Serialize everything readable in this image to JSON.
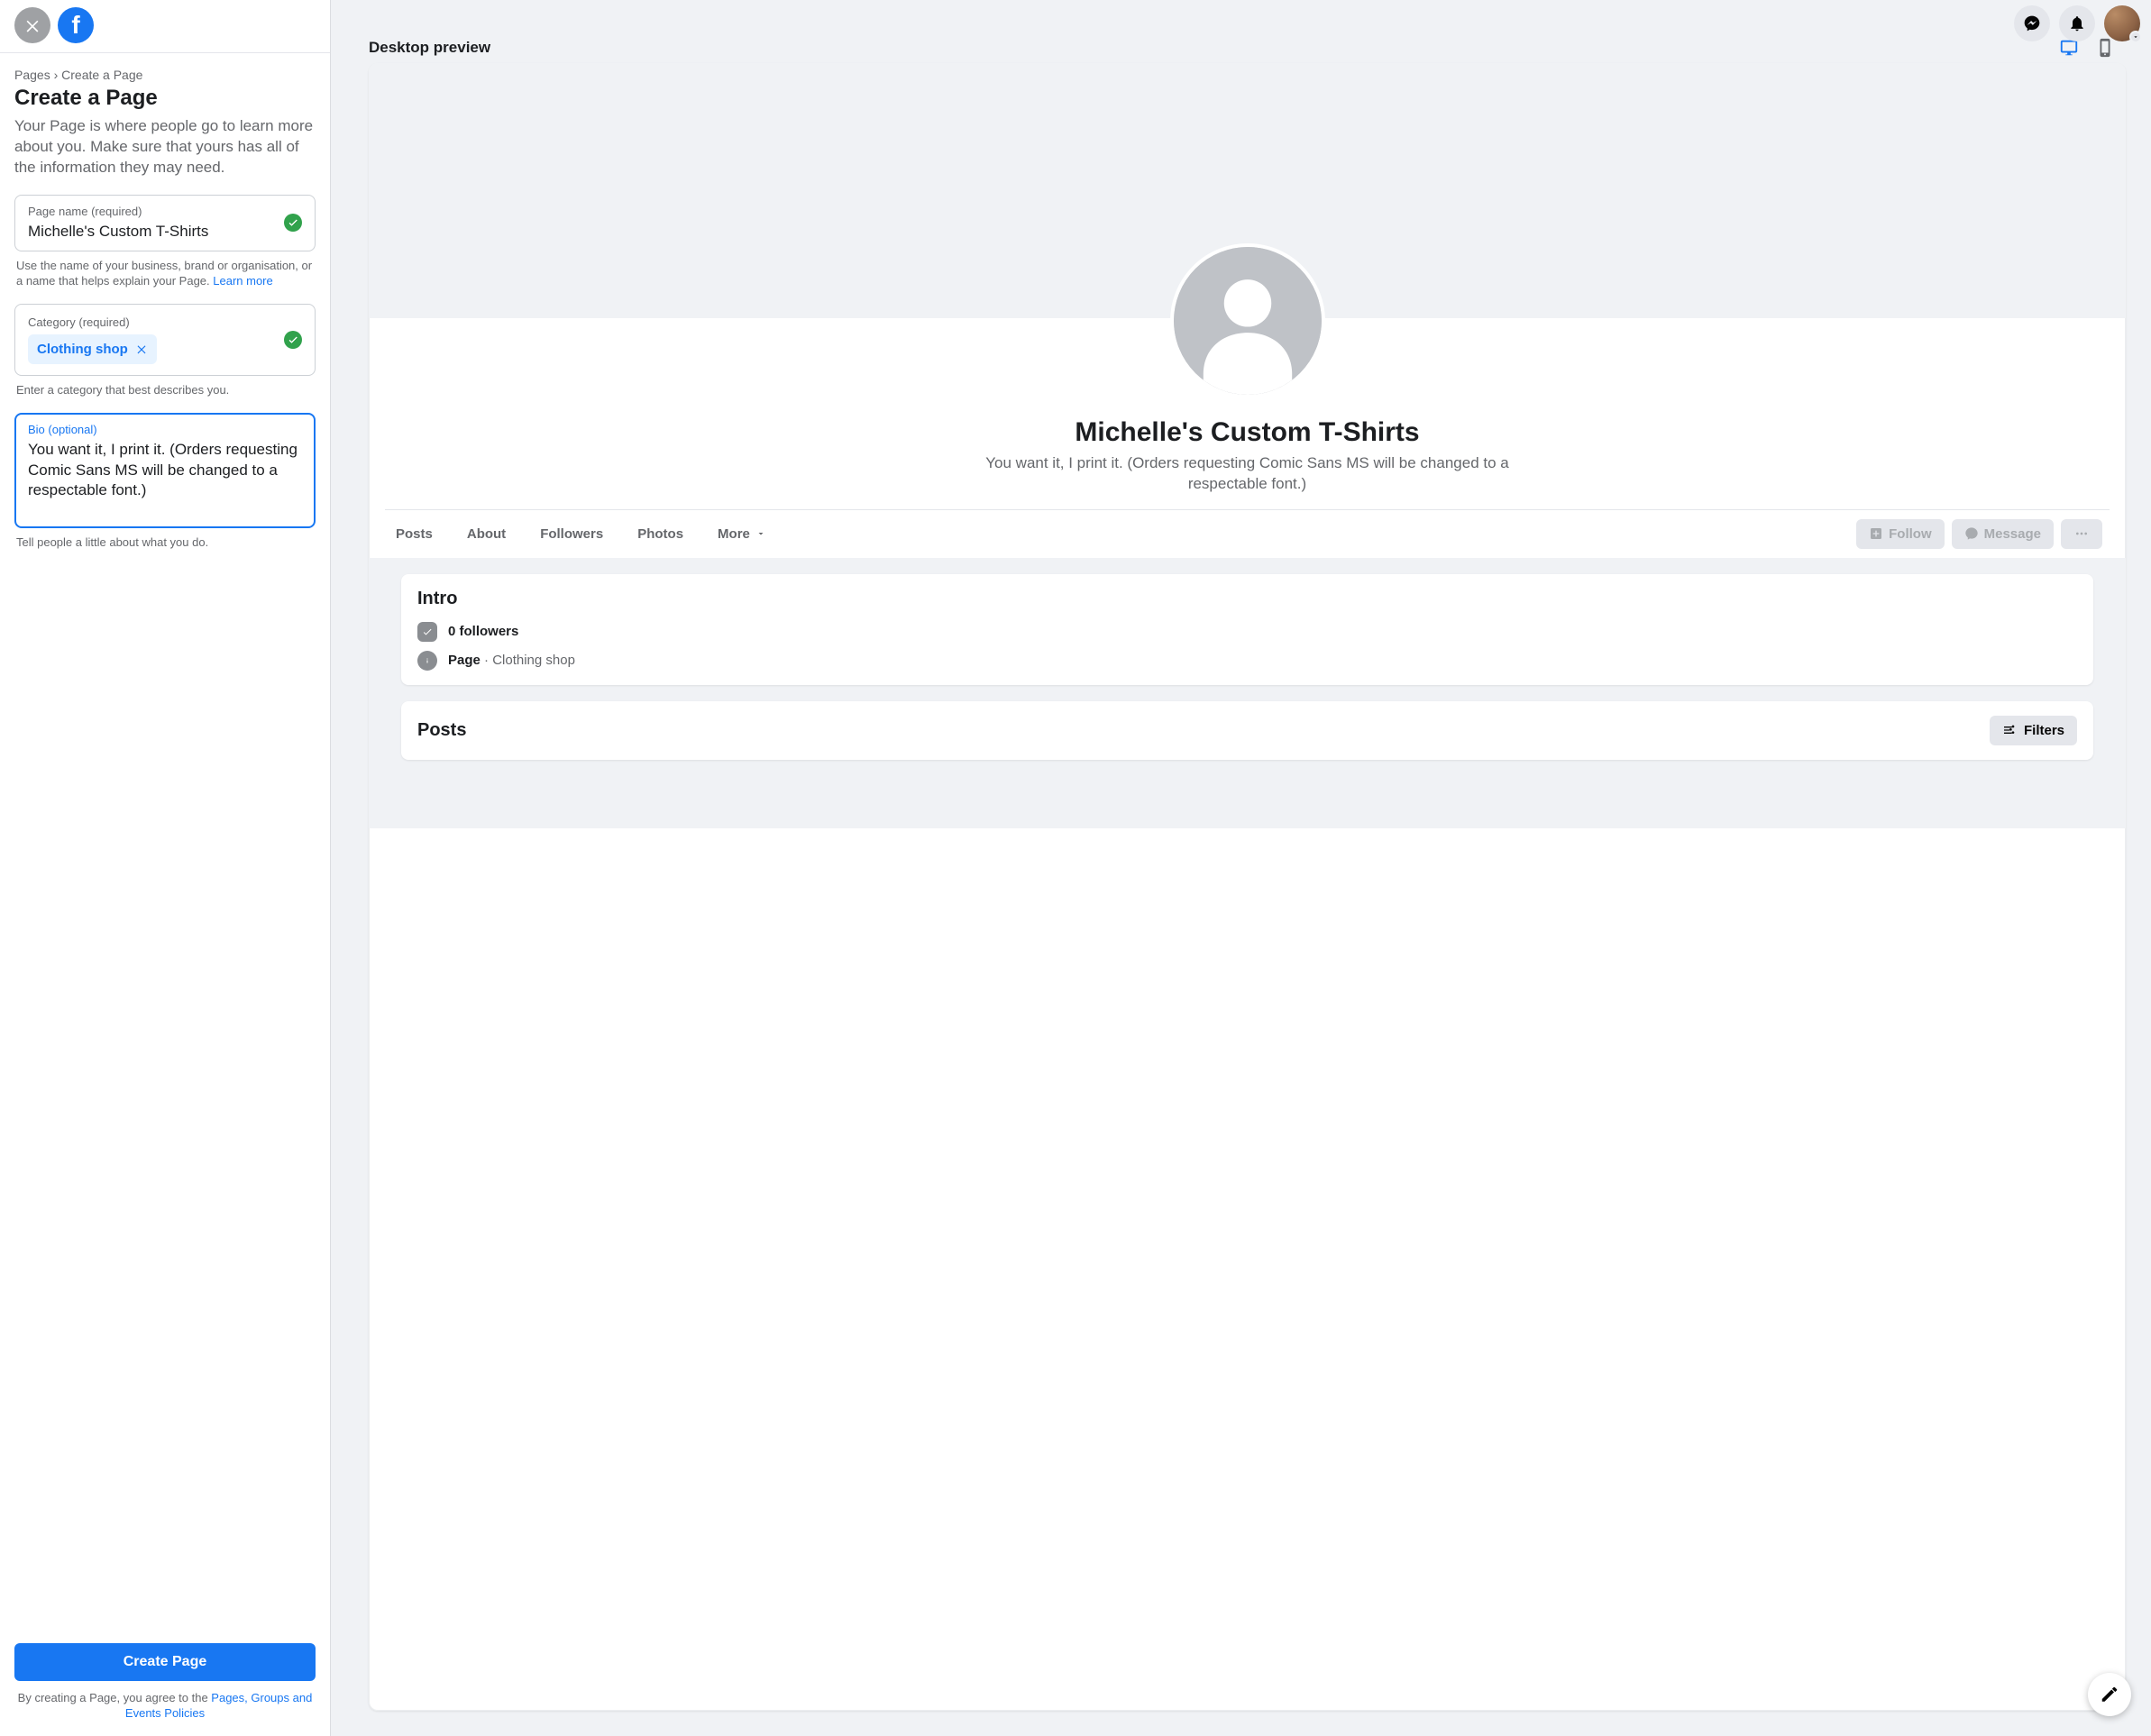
{
  "sidebar": {
    "breadcrumb": "Pages › Create a Page",
    "title": "Create a Page",
    "subtitle": "Your Page is where people go to learn more about you. Make sure that yours has all of the information they may need.",
    "pageName": {
      "label": "Page name (required)",
      "value": "Michelle's Custom T-Shirts",
      "helper_pre": "Use the name of your business, brand or organisation, or a name that helps explain your Page. ",
      "helper_link": "Learn more"
    },
    "category": {
      "label": "Category (required)",
      "chip": "Clothing shop",
      "helper": "Enter a category that best describes you."
    },
    "bio": {
      "label": "Bio (optional)",
      "value": "You want it, I print it. (Orders requesting Comic Sans MS will be changed to a respectable font.)",
      "helper": "Tell people a little about what you do."
    },
    "createBtn": "Create Page",
    "footer_pre": "By creating a Page, you agree to the ",
    "footer_link": "Pages, Groups and Events Policies"
  },
  "preview": {
    "headerTitle": "Desktop preview",
    "name": "Michelle's Custom T-Shirts",
    "bio": "You want it, I print it. (Orders requesting Comic Sans MS will be changed to a respectable font.)",
    "tabs": {
      "posts": "Posts",
      "about": "About",
      "followers": "Followers",
      "photos": "Photos",
      "more": "More"
    },
    "actions": {
      "follow": "Follow",
      "message": "Message"
    },
    "intro": {
      "title": "Intro",
      "followers": "0 followers",
      "pageLabel": "Page",
      "category": " · Clothing shop"
    },
    "posts": {
      "title": "Posts",
      "filters": "Filters"
    }
  }
}
